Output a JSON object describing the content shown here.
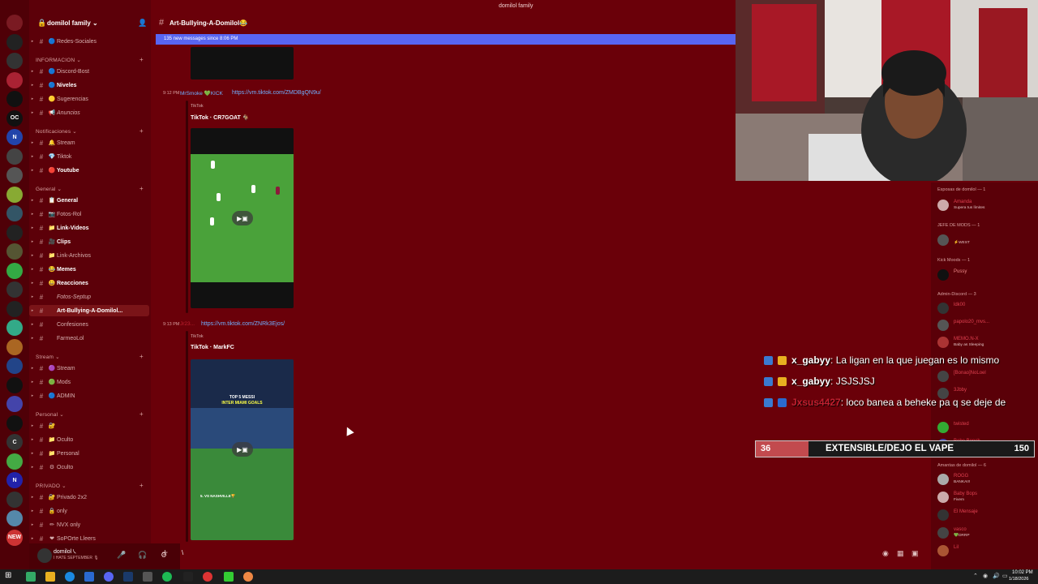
{
  "window": {
    "title": "domilol family"
  },
  "server": {
    "name": "domilol family ⌄"
  },
  "rail": [
    {
      "label": "",
      "color": "#7a1a22"
    },
    {
      "label": "",
      "color": "#222"
    },
    {
      "label": "",
      "color": "#333"
    },
    {
      "label": "",
      "color": "#a23"
    },
    {
      "label": "",
      "color": "#111"
    },
    {
      "label": "OC",
      "color": "#111"
    },
    {
      "label": "N",
      "color": "#24a"
    },
    {
      "label": "",
      "color": "#444"
    },
    {
      "label": "",
      "color": "#555"
    },
    {
      "label": "",
      "color": "#8a3"
    },
    {
      "label": "",
      "color": "#356"
    },
    {
      "label": "",
      "color": "#222"
    },
    {
      "label": "",
      "color": "#553"
    },
    {
      "label": "",
      "color": "#3a4"
    },
    {
      "label": "",
      "color": "#333"
    },
    {
      "label": "",
      "color": "#222"
    },
    {
      "label": "",
      "color": "#3a8"
    },
    {
      "label": "",
      "color": "#a62"
    },
    {
      "label": "",
      "color": "#248"
    },
    {
      "label": "",
      "color": "#111"
    },
    {
      "label": "",
      "color": "#44a"
    },
    {
      "label": "",
      "color": "#111"
    },
    {
      "label": "C",
      "color": "#333"
    },
    {
      "label": "",
      "color": "#4a4"
    },
    {
      "label": "N",
      "color": "#22a"
    },
    {
      "label": "",
      "color": "#333"
    },
    {
      "label": "",
      "color": "#58a"
    },
    {
      "label": "NEW",
      "color": "#c33"
    }
  ],
  "rail_badges": [
    "1",
    "",
    "",
    "",
    "",
    "",
    "",
    "",
    "",
    "",
    "",
    "",
    "",
    "",
    "",
    "",
    "",
    "",
    "",
    "",
    "",
    "",
    "",
    "",
    "",
    "",
    "",
    ""
  ],
  "sidebar": {
    "categories": [
      {
        "label": "INFORMACION ⌄"
      },
      {
        "label": "Notificaciones ⌄"
      },
      {
        "label": "General ⌄"
      },
      {
        "label": "Stream ⌄"
      },
      {
        "label": "Personal ⌄"
      },
      {
        "label": "PRIVADO ⌄"
      }
    ],
    "channels": [
      {
        "emoji": "🔵",
        "name": "Redes-Sociales",
        "bold": false
      },
      {
        "emoji": "🔵",
        "name": "Discord-Bost",
        "bold": false
      },
      {
        "emoji": "🔵",
        "name": "Niveles",
        "bold": true
      },
      {
        "emoji": "🟡",
        "name": "Sugerencias",
        "bold": false
      },
      {
        "emoji": "📢",
        "name": "Anuncios",
        "bold": false
      },
      {
        "emoji": "🔔",
        "name": "Stream",
        "bold": false
      },
      {
        "emoji": "💎",
        "name": "Tiktok",
        "bold": false
      },
      {
        "emoji": "🔴",
        "name": "Youtube",
        "bold": true
      },
      {
        "emoji": "📋",
        "name": "General",
        "bold": true
      },
      {
        "emoji": "📷",
        "name": "Fotos-Rol",
        "bold": false
      },
      {
        "emoji": "📁",
        "name": "Link-Videos",
        "bold": true
      },
      {
        "emoji": "🎥",
        "name": "Clips",
        "bold": true
      },
      {
        "emoji": "📁",
        "name": "Link-Archivos",
        "bold": false
      },
      {
        "emoji": "😂",
        "name": "Memes",
        "bold": true
      },
      {
        "emoji": "😀",
        "name": "Reacciones",
        "bold": true
      },
      {
        "emoji": "",
        "name": "Fotos-Septup",
        "bold": false
      },
      {
        "emoji": "",
        "name": "Art-Bullying-A-Domilol...",
        "bold": true
      },
      {
        "emoji": "",
        "name": "Confesiones",
        "bold": false
      },
      {
        "emoji": "",
        "name": "FarmeoLol",
        "bold": false
      },
      {
        "emoji": "🟣",
        "name": "Stream",
        "bold": false
      },
      {
        "emoji": "🟢",
        "name": "Mods",
        "bold": false
      },
      {
        "emoji": "🔵",
        "name": "ADMIN",
        "bold": false
      },
      {
        "emoji": "🔐",
        "name": "",
        "bold": false
      },
      {
        "emoji": "📁",
        "name": "Oculto",
        "bold": false
      },
      {
        "emoji": "📁",
        "name": "Personal",
        "bold": false
      },
      {
        "emoji": "⚙",
        "name": "Oculto",
        "bold": false
      },
      {
        "emoji": "🔐",
        "name": "Privado 2x2",
        "bold": false
      },
      {
        "emoji": "🔒",
        "name": "only",
        "bold": false
      },
      {
        "emoji": "✏",
        "name": "NVX only",
        "bold": false
      },
      {
        "emoji": "❤",
        "name": "SoPOrte Lleers",
        "bold": false
      }
    ],
    "user": {
      "name": "domilol㇏",
      "status": "I HATE SEPTEMBER 🎙"
    }
  },
  "chat": {
    "channel_title": "Art-Bullying-A-Domilol😂",
    "new_messages": "135 new messages since 8:06 PM",
    "messages": [
      {
        "time": "9:12 PM",
        "author": "MrSmoke 💚KICK",
        "link": "https://vm.tiktok.com/ZMDBgQN9u/",
        "provider": "TikTok",
        "embed_title": "TikTok · CR7GOAT 🐐"
      },
      {
        "time": "9:13 PM",
        "author": "Jr23...",
        "link": "https://vm.tiktok.com/ZNRk3Ejos/",
        "provider": "TikTok",
        "embed_title": "TikTok · MarkFC",
        "video_text_1": "TOP 5 MESSI",
        "video_text_2": "INTER MIAMI GOALS",
        "video_text_3": "5. VS NASHVILLE🏆"
      }
    ],
    "composer_text": "\\"
  },
  "members": {
    "groups": [
      {
        "label": "Esposas de domilol — 1"
      },
      {
        "label": "JEFE DE MODS — 1"
      },
      {
        "label": "Kick Moods — 1"
      },
      {
        "label": "Admin-Discord — 3"
      },
      {
        "label": "Amantas de domilol — 6"
      }
    ],
    "items": [
      {
        "name": "Amanda",
        "status": "Supera tus límites",
        "color": "#e04050",
        "av": "#caa"
      },
      {
        "name": "",
        "status": "⚡WEST",
        "color": "#fff",
        "av": "#555"
      },
      {
        "name": "Pussy",
        "status": "",
        "color": "#e88",
        "av": "#111"
      },
      {
        "name": "ldk00",
        "status": "",
        "color": "#e04050",
        "av": "#333"
      },
      {
        "name": "papolo20_mvs...",
        "status": "",
        "color": "#e04050",
        "av": "#555"
      },
      {
        "name": "MEMO.N-X",
        "status": "Baby as Sleeping",
        "color": "#e04050",
        "av": "#a33"
      },
      {
        "name": "[Bonao]NoLoel",
        "status": "",
        "color": "#e04050",
        "av": "#444"
      },
      {
        "name": "3Jbby",
        "status": "",
        "color": "#e04050",
        "av": "#444"
      },
      {
        "name": "twisted",
        "status": "",
        "color": "#e04050",
        "av": "#3a3"
      },
      {
        "name": "Bebe.Bench",
        "status": "",
        "color": "#e04050",
        "av": "#44a"
      },
      {
        "name": "ROGG",
        "status": "BANKAI!!",
        "color": "#e04050",
        "av": "#aaa"
      },
      {
        "name": "Baby Bops",
        "status": "Fivem",
        "color": "#e04050",
        "av": "#caa"
      },
      {
        "name": "El Mensaje",
        "status": "",
        "color": "#e04050",
        "av": "#333"
      },
      {
        "name": "vasco",
        "status": "💚DRRP",
        "color": "#e04050",
        "av": "#444"
      },
      {
        "name": "Lil",
        "status": "",
        "color": "#e04050",
        "av": "#a53"
      }
    ]
  },
  "overlay": {
    "lines": [
      {
        "user": "x_gabyy",
        "text": " : La ligan en la que juegan es lo mismo",
        "user_color": "#ffffff"
      },
      {
        "user": "x_gabyy",
        "text": " : JSJSJSJ",
        "user_color": "#ffffff"
      },
      {
        "user": "Jxsus4427",
        "text": " : loco banea a beheke pa q se deje de",
        "user_color": "#c02030"
      }
    ],
    "poll": {
      "left_value": "36",
      "label": "EXTENSIBLE/DEJO EL VAPE",
      "right_value": "150",
      "fraction": 0.19
    }
  },
  "taskbar": {
    "time": "10:02 PM",
    "date": "1/18/2026"
  }
}
